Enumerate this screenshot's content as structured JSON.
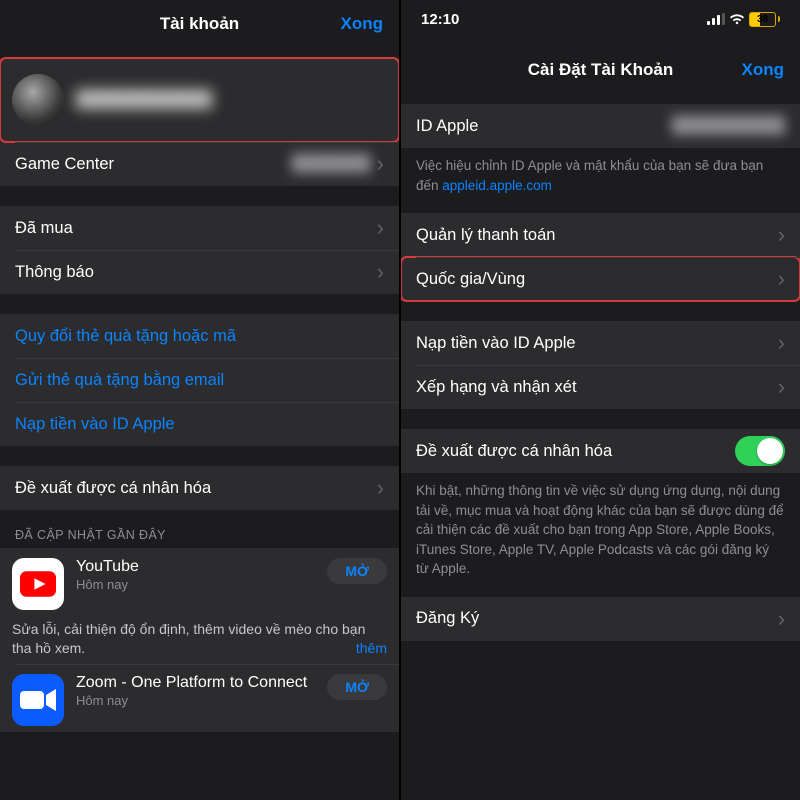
{
  "left": {
    "nav": {
      "title": "Tài khoản",
      "done": "Xong"
    },
    "profile": {
      "name_masked": "████████████"
    },
    "game_center": {
      "label": "Game Center",
      "value_masked": "███████"
    },
    "group2": [
      {
        "label": "Đã mua"
      },
      {
        "label": "Thông báo"
      }
    ],
    "links": [
      "Quy đổi thẻ quà tặng hoặc mã",
      "Gửi thẻ quà tặng bằng email",
      "Nạp tiền vào ID Apple"
    ],
    "personalized": "Đề xuất được cá nhân hóa",
    "updated_header": "ĐÃ CẬP NHẬT GẦN ĐÂY",
    "apps": [
      {
        "name": "YouTube",
        "sub": "Hôm nay",
        "open": "MỞ",
        "desc": "Sửa lỗi, cải thiện độ ổn định, thêm video về mèo cho bạn tha hồ xem.",
        "more": "thêm"
      },
      {
        "name": "Zoom - One Platform to Connect",
        "sub": "Hôm nay",
        "open": "MỞ"
      }
    ]
  },
  "right": {
    "status": {
      "time": "12:10",
      "battery_pct": "38"
    },
    "nav": {
      "title": "Cài Đặt Tài Khoản",
      "done": "Xong"
    },
    "apple_id": {
      "label": "ID Apple",
      "value_masked": "██████████"
    },
    "apple_id_foot_pre": "Việc hiệu chỉnh ID Apple và mật khẩu của bạn sẽ đưa bạn đến ",
    "apple_id_foot_link": "appleid.apple.com",
    "group2": [
      {
        "label": "Quản lý thanh toán"
      },
      {
        "label": "Quốc gia/Vùng",
        "hl": true
      }
    ],
    "group3": [
      {
        "label": "Nạp tiền vào ID Apple"
      },
      {
        "label": "Xếp hạng và nhận xét"
      }
    ],
    "personalized": {
      "label": "Đề xuất được cá nhân hóa",
      "on": true
    },
    "personalized_foot": "Khi bật, những thông tin về việc sử dụng ứng dụng, nội dung tải về, mục mua và hoạt động khác của bạn sẽ được dùng để cải thiện các đề xuất cho bạn trong App Store, Apple Books, iTunes Store, Apple TV, Apple Podcasts và các gói đăng ký từ Apple.",
    "subscribe": "Đăng Ký"
  }
}
